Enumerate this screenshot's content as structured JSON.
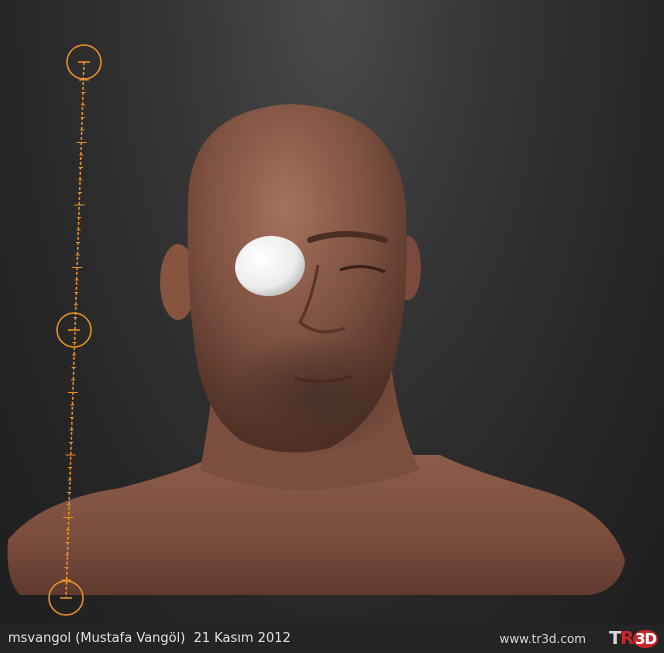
{
  "viewport": {
    "subject": "sculpted-head-bust",
    "colors": {
      "background": "#2e2e2e",
      "skin": "#8a5a48",
      "eyeball": "#f2f2f2",
      "gizmo": "#e8902a"
    }
  },
  "gizmo": {
    "icons": [
      "transpose-start-ring-icon",
      "transpose-middle-ring-icon",
      "transpose-end-ring-icon"
    ]
  },
  "footer": {
    "credit": "msvangol (Mustafa Vangöl)  21 Kasım 2012",
    "website": "www.tr3d.com",
    "logo": {
      "letter1": "T",
      "letter2": "R",
      "letter3": "3D"
    }
  }
}
